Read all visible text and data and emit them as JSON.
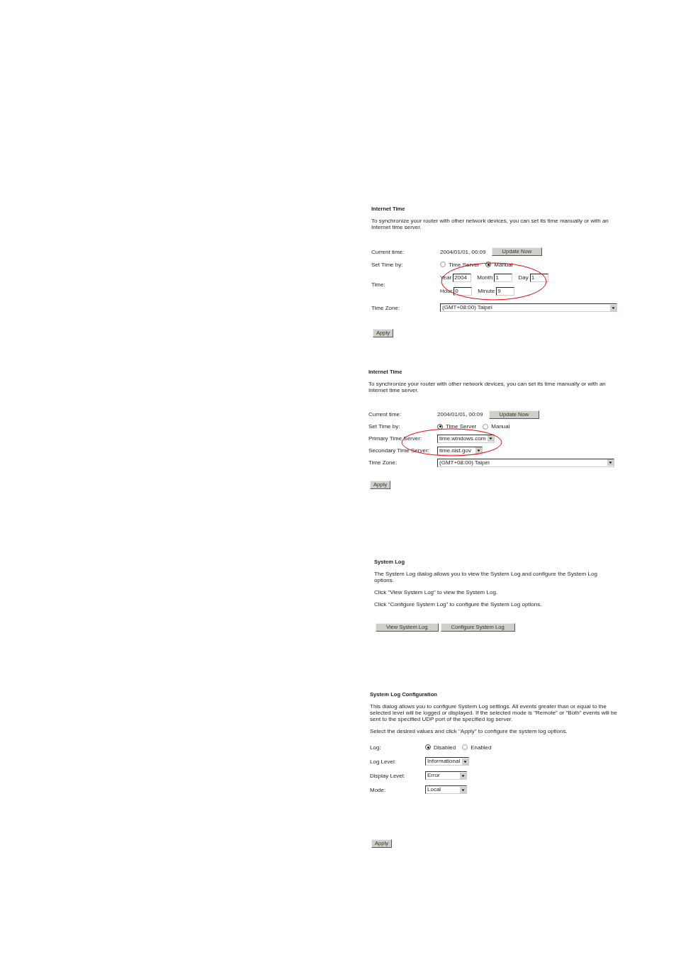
{
  "panels": [
    {
      "title": "Internet Time",
      "paragraphs": [
        "To synchronize your router with other network devices, you can set its time manually or with an Internet time server."
      ],
      "rows": [
        {
          "kind": "info",
          "label": "Current time:",
          "value": "2004/01/01, 00:09",
          "button": "Update Now"
        },
        {
          "kind": "radio",
          "label": "Set Time by:",
          "options": [
            {
              "label": "Time Server",
              "selected": false
            },
            {
              "label": "Manual",
              "selected": true
            }
          ]
        },
        {
          "kind": "fields",
          "label": "Time:",
          "circled": true,
          "lines": [
            [
              {
                "label": "Year",
                "value": "2004"
              },
              {
                "label": "Month",
                "value": "1"
              },
              {
                "label": "Day",
                "value": "1"
              }
            ],
            [
              {
                "label": "Hour",
                "value": "0"
              },
              {
                "label": "Minute",
                "value": "9"
              }
            ]
          ]
        },
        {
          "kind": "wide_select",
          "label": "Time Zone:",
          "value": "(GMT+08:00) Taipei"
        }
      ],
      "buttons": [
        "Apply"
      ]
    },
    {
      "title": "Internet Time",
      "paragraphs": [
        "To synchronize your router with other network devices, you can set its time manually or with an Internet time server."
      ],
      "rows": [
        {
          "kind": "info",
          "label": "Current time:",
          "value": "2004/01/01, 00:09",
          "button": "Update Now"
        },
        {
          "kind": "radio",
          "label": "Set Time by:",
          "options": [
            {
              "label": "Time Server",
              "selected": true
            },
            {
              "label": "Manual",
              "selected": false
            }
          ]
        },
        {
          "kind": "select",
          "label": "Primary Time Server:",
          "value": "time.windows.com",
          "circled": true
        },
        {
          "kind": "select",
          "label": "Secondary Time Server:",
          "value": "time.nist.gov",
          "circled": true
        },
        {
          "kind": "wide_select",
          "label": "Time Zone:",
          "value": "(GMT+08:00) Taipei"
        }
      ],
      "buttons": [
        "Apply"
      ]
    },
    {
      "title": "System Log",
      "paragraphs": [
        "The System Log dialog allows you to view the System Log and configure the System Log options.",
        "Click \"View System Log\" to view the System Log.",
        "Click \"Configure System Log\" to configure the System Log options."
      ],
      "buttons": [
        "View System Log",
        "Configure System Log"
      ]
    },
    {
      "title": "System Log Configuration",
      "paragraphs": [
        "This dialog allows you to configure System Log settings. All events greater than or equal to the selected level will be logged or displayed. If the selected mode is \"Remote\" or \"Both\" events will be sent to the specified UDP port of the specified log server.",
        "Select the desired values and click \"Apply\" to configure the system log options."
      ],
      "rows": [
        {
          "kind": "radio",
          "label": "Log:",
          "options": [
            {
              "label": "Disabled",
              "selected": true
            },
            {
              "label": "Enabled",
              "selected": false
            }
          ]
        },
        {
          "kind": "select",
          "label": "Log Level:",
          "value": "Informational"
        },
        {
          "kind": "select",
          "label": "Display Level:",
          "value": "Error"
        },
        {
          "kind": "select",
          "label": "Mode:",
          "value": "Local"
        }
      ],
      "buttons": [
        "Apply"
      ]
    }
  ]
}
